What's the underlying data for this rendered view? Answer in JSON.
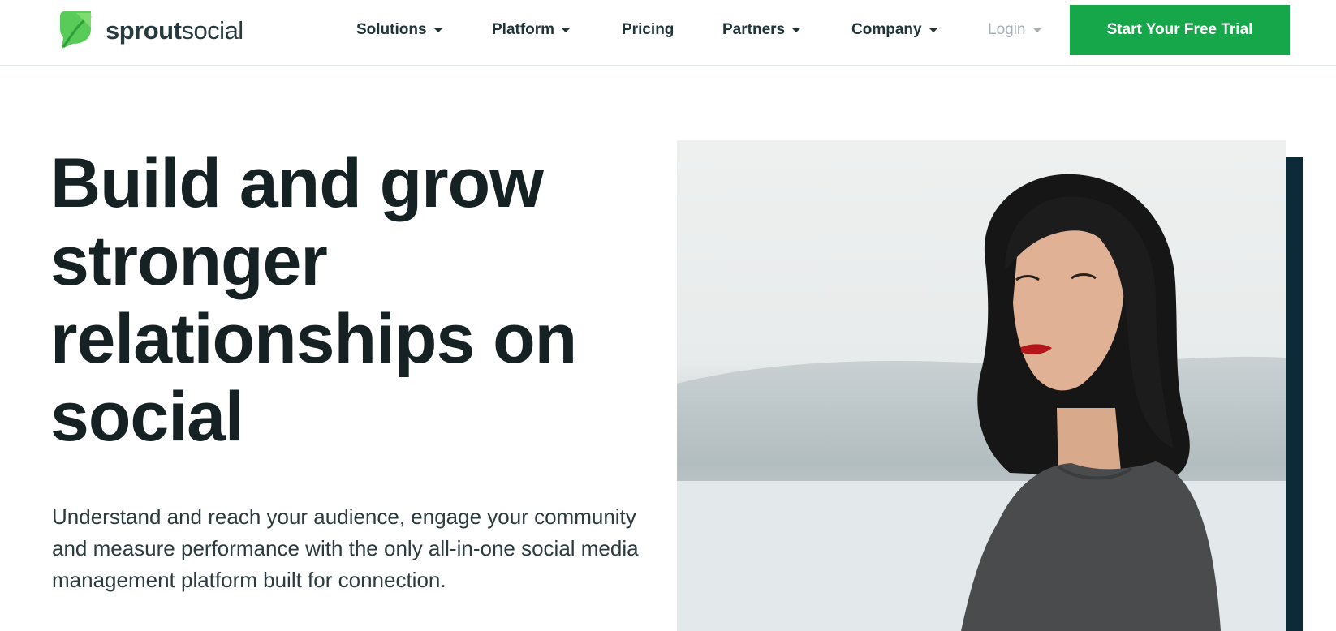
{
  "brand": {
    "name_bold": "sprout",
    "name_light": "social",
    "logo_icon": "leaf-icon",
    "color": "#59cb59"
  },
  "nav": {
    "items": [
      {
        "label": "Solutions",
        "has_dropdown": true
      },
      {
        "label": "Platform",
        "has_dropdown": true
      },
      {
        "label": "Pricing",
        "has_dropdown": false
      },
      {
        "label": "Partners",
        "has_dropdown": true
      },
      {
        "label": "Company",
        "has_dropdown": true
      },
      {
        "label": "Login",
        "has_dropdown": true
      }
    ],
    "cta_label": "Start Your Free Trial",
    "cta_color": "#15a74a"
  },
  "hero": {
    "headline": "Build and grow stronger relationships on social",
    "subheadline": "Understand and reach your audience, engage your community and measure performance with the only all-in-one social media management platform built for connection.",
    "accent_color": "#0d2a38"
  }
}
